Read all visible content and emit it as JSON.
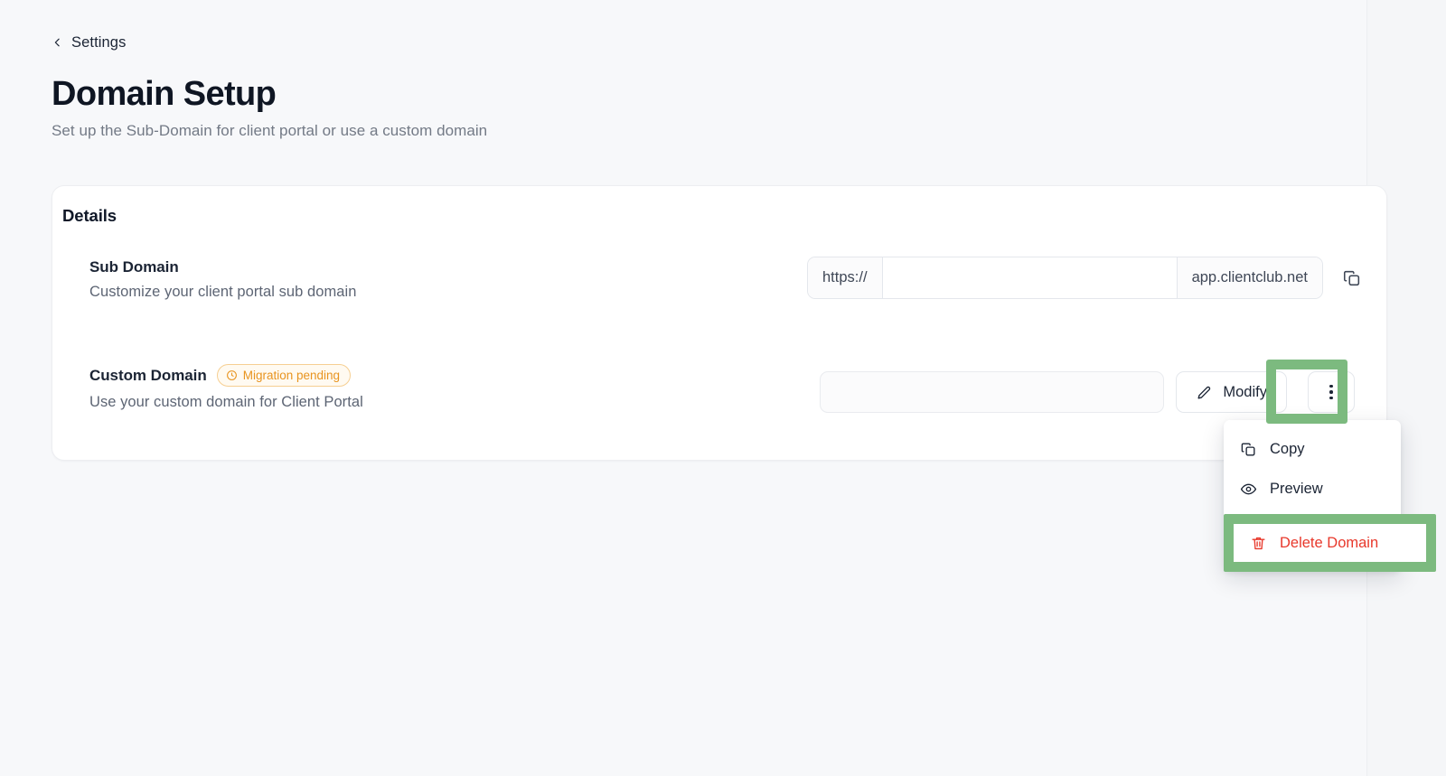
{
  "header": {
    "back_label": "Settings",
    "back_icon": "chevron-left-icon",
    "title": "Domain Setup",
    "subtitle": "Set up the Sub-Domain for client portal or use a custom domain"
  },
  "card": {
    "title": "Details",
    "rows": [
      {
        "id": "sub-domain",
        "title": "Sub Domain",
        "description": "Customize your client portal sub domain",
        "prefix": "https://",
        "input_value": "",
        "input_placeholder": "",
        "suffix": "app.clientclub.net",
        "copy_icon": "copy-icon"
      },
      {
        "id": "custom-domain",
        "title": "Custom Domain",
        "badge": {
          "label": "Migration pending",
          "icon": "clock-icon",
          "color": "#e8941f",
          "bg": "#fffaf1",
          "border": "#f6cf92"
        },
        "description": "Use your custom domain for Client Portal",
        "input_value": "",
        "input_placeholder": "",
        "modify_label": "Modify",
        "modify_icon": "pencil-icon",
        "more_icon": "kebab-menu-icon"
      }
    ]
  },
  "menu": {
    "items": [
      {
        "label": "Copy",
        "icon": "copy-icon",
        "danger": false
      },
      {
        "label": "Preview",
        "icon": "eye-icon",
        "danger": false
      },
      {
        "label": "Delete Domain",
        "icon": "trash-icon",
        "danger": true
      }
    ]
  },
  "highlights": {
    "color": "#7cba7f",
    "targets": [
      "more-options-button",
      "menu-item-delete-domain"
    ]
  }
}
